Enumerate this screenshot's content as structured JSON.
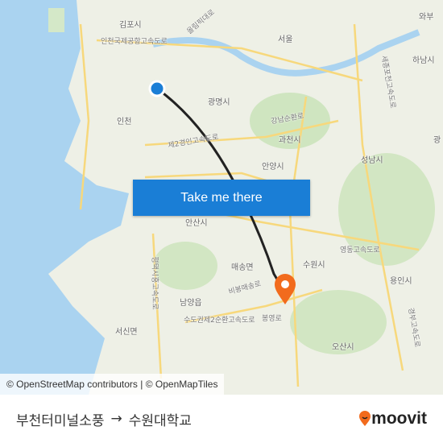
{
  "map": {
    "labels": [
      "김포시",
      "서울",
      "와부",
      "하남시",
      "광명시",
      "인천",
      "과천시",
      "성남시",
      "안양시",
      "안산시",
      "매송면",
      "수원시",
      "용인시",
      "남양읍",
      "서신면",
      "오산시",
      "광"
    ],
    "roads": [
      "올림픽대로",
      "인천국제공항고속도로",
      "수도권제2순환고속도로",
      "제2경인고속도로",
      "강남순환로",
      "영동고속도로",
      "평택시흥고속도로",
      "비봉매송로",
      "봉영로",
      "세종포천고속도로",
      "경부고속도로"
    ],
    "route_color": "#222222",
    "origin_color": "#1a7ed6",
    "destination_color": "#f26b1d"
  },
  "cta": {
    "label": "Take me there"
  },
  "attribution": "© OpenStreetMap contributors | © OpenMapTiles",
  "footer": {
    "origin": "부천터미널소풍",
    "arrow": "→",
    "destination": "수원대학교",
    "brand": "moovit",
    "brand_color": "#f26b1d"
  }
}
